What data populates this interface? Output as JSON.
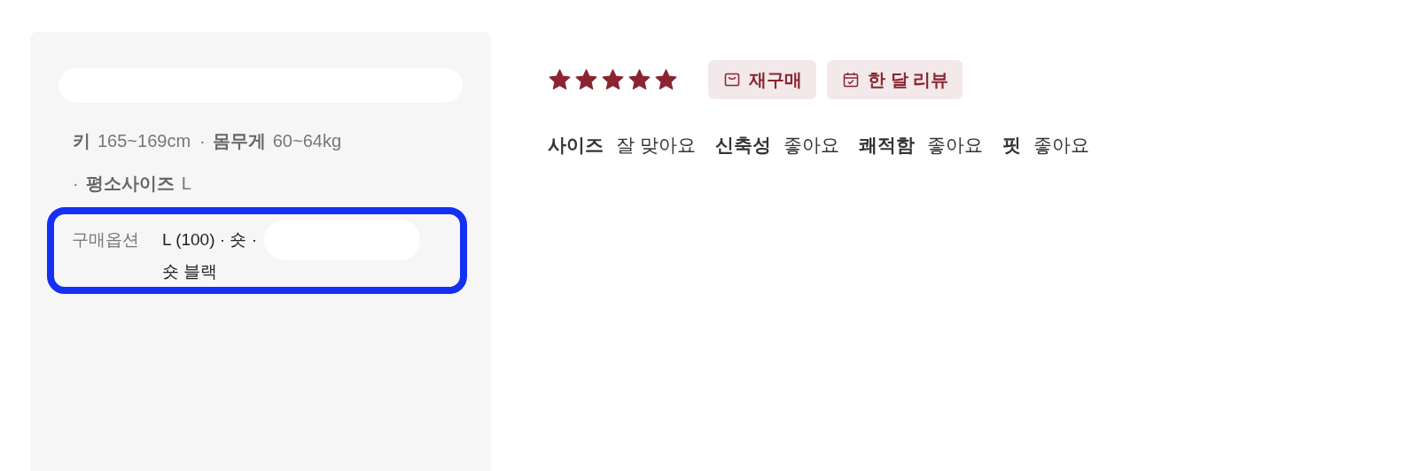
{
  "reviewer": {
    "profile": [
      {
        "label": "키",
        "value": "165~169cm"
      },
      {
        "label": "몸무게",
        "value": "60~64kg"
      },
      {
        "label": "평소사이즈",
        "value": "L"
      }
    ],
    "separator": "·",
    "option": {
      "label": "구매옵션",
      "value_line1": "L (100) · 숏 ·",
      "value_line2": "숏 블랙",
      "highlighted": true
    }
  },
  "review": {
    "stars": 5,
    "badges": [
      {
        "kind": "bag",
        "label": "재구매"
      },
      {
        "kind": "calendar",
        "label": "한 달 리뷰"
      }
    ],
    "aspects": [
      {
        "name": "사이즈",
        "value": "잘 맞아요"
      },
      {
        "name": "신축성",
        "value": "좋아요"
      },
      {
        "name": "쾌적함",
        "value": "좋아요"
      },
      {
        "name": "핏",
        "value": "좋아요"
      }
    ]
  }
}
